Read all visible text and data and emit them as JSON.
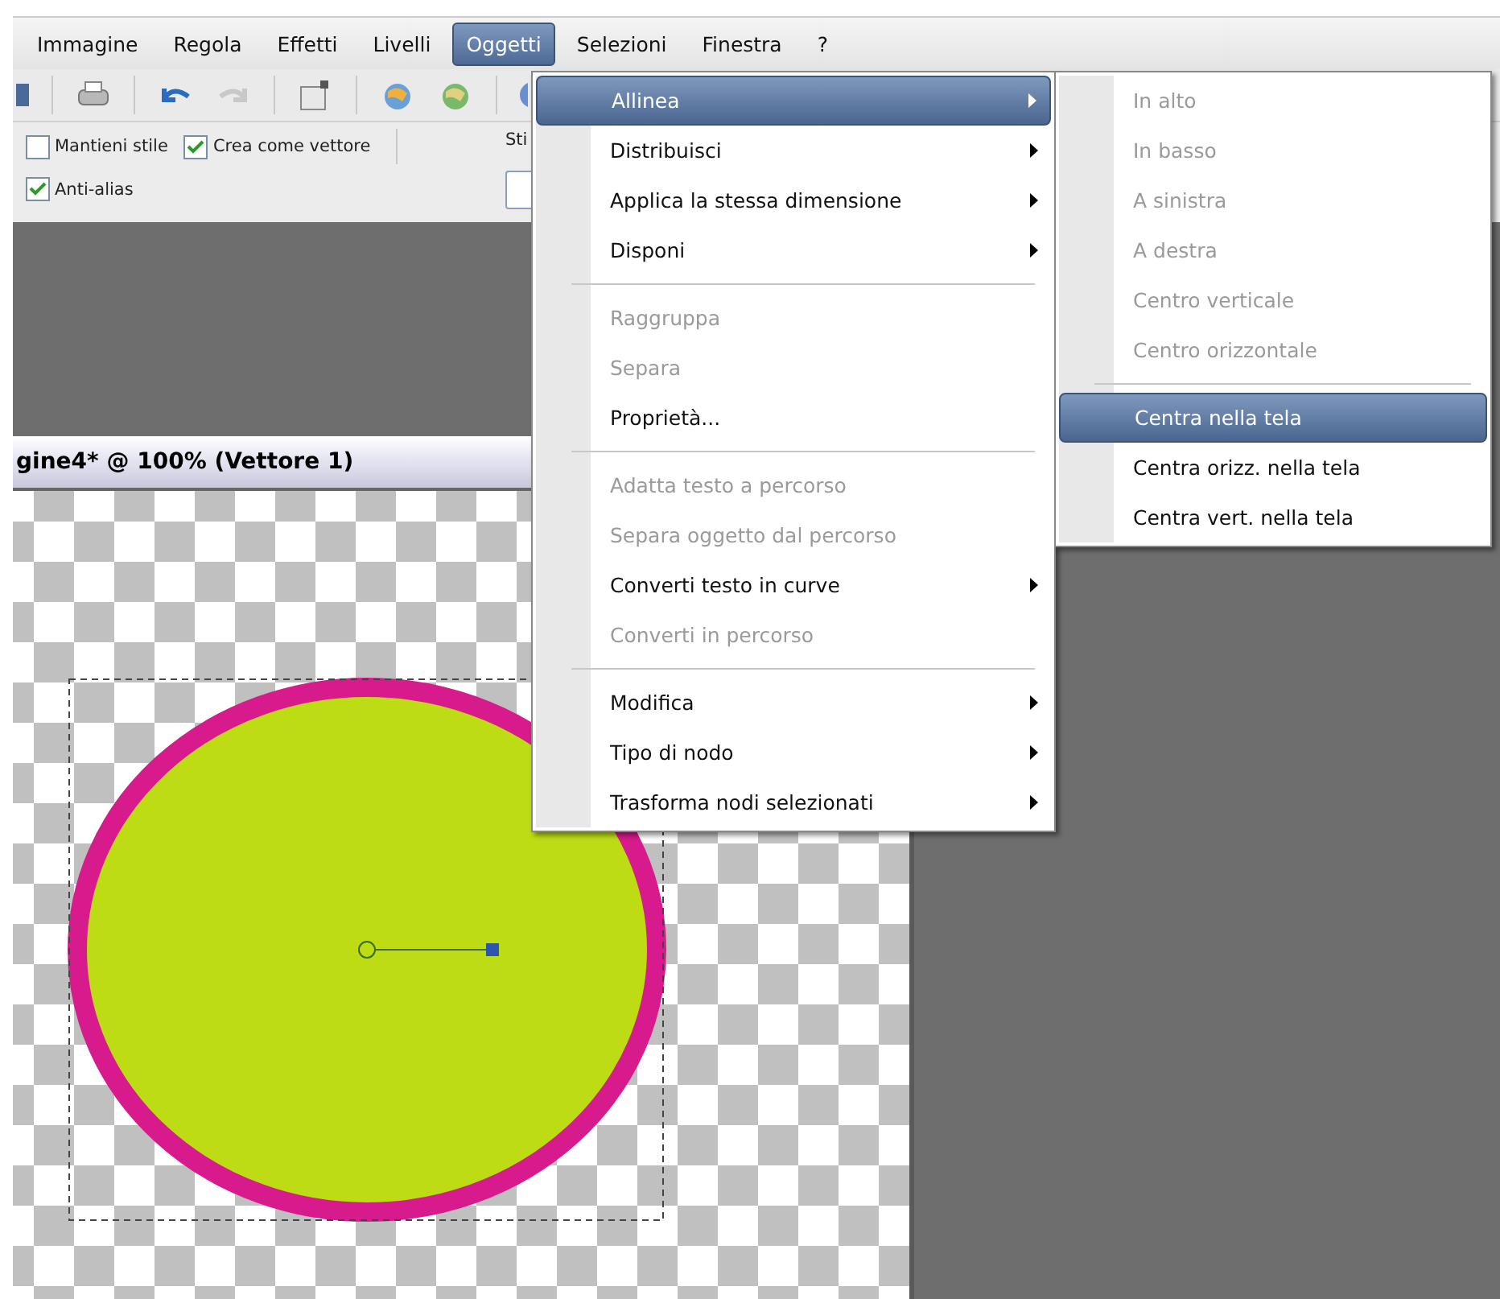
{
  "menubar": [
    {
      "label": "Immagine",
      "selected": false
    },
    {
      "label": "Regola",
      "selected": false
    },
    {
      "label": "Effetti",
      "selected": false
    },
    {
      "label": "Livelli",
      "selected": false
    },
    {
      "label": "Oggetti",
      "selected": true
    },
    {
      "label": "Selezioni",
      "selected": false
    },
    {
      "label": "Finestra",
      "selected": false
    },
    {
      "label": "?",
      "selected": false
    }
  ],
  "options": {
    "checkboxes": [
      {
        "label": "Mantieni stile",
        "checked": false
      },
      {
        "label": "Crea come vettore",
        "checked": true
      },
      {
        "label": "Anti-alias",
        "checked": true
      }
    ],
    "style_label": "Sti"
  },
  "document": {
    "title": "gine4* @ 100% (Vettore 1)"
  },
  "menu": {
    "items": [
      {
        "kind": "item",
        "label": "Allinea",
        "selected": true,
        "disabled": false,
        "submenu": true
      },
      {
        "kind": "item",
        "label": "Distribuisci",
        "selected": false,
        "disabled": false,
        "submenu": true
      },
      {
        "kind": "item",
        "label": "Applica la stessa dimensione",
        "selected": false,
        "disabled": false,
        "submenu": true
      },
      {
        "kind": "item",
        "label": "Disponi",
        "selected": false,
        "disabled": false,
        "submenu": true
      },
      {
        "kind": "separator"
      },
      {
        "kind": "item",
        "label": "Raggruppa",
        "selected": false,
        "disabled": true,
        "submenu": false
      },
      {
        "kind": "item",
        "label": "Separa",
        "selected": false,
        "disabled": true,
        "submenu": false
      },
      {
        "kind": "item",
        "label": "Proprietà...",
        "selected": false,
        "disabled": false,
        "submenu": false
      },
      {
        "kind": "separator"
      },
      {
        "kind": "item",
        "label": "Adatta testo a percorso",
        "selected": false,
        "disabled": true,
        "submenu": false
      },
      {
        "kind": "item",
        "label": "Separa oggetto dal percorso",
        "selected": false,
        "disabled": true,
        "submenu": false
      },
      {
        "kind": "item",
        "label": "Converti testo in curve",
        "selected": false,
        "disabled": false,
        "submenu": true
      },
      {
        "kind": "item",
        "label": "Converti in percorso",
        "selected": false,
        "disabled": true,
        "submenu": false
      },
      {
        "kind": "separator"
      },
      {
        "kind": "item",
        "label": "Modifica",
        "selected": false,
        "disabled": false,
        "submenu": true
      },
      {
        "kind": "item",
        "label": "Tipo di nodo",
        "selected": false,
        "disabled": false,
        "submenu": true
      },
      {
        "kind": "item",
        "label": "Trasforma nodi selezionati",
        "selected": false,
        "disabled": false,
        "submenu": true
      }
    ]
  },
  "submenu": {
    "items": [
      {
        "kind": "item",
        "label": "In alto",
        "selected": false,
        "disabled": true,
        "submenu": false
      },
      {
        "kind": "item",
        "label": "In basso",
        "selected": false,
        "disabled": true,
        "submenu": false
      },
      {
        "kind": "item",
        "label": "A sinistra",
        "selected": false,
        "disabled": true,
        "submenu": false
      },
      {
        "kind": "item",
        "label": "A destra",
        "selected": false,
        "disabled": true,
        "submenu": false
      },
      {
        "kind": "item",
        "label": "Centro verticale",
        "selected": false,
        "disabled": true,
        "submenu": false
      },
      {
        "kind": "item",
        "label": "Centro orizzontale",
        "selected": false,
        "disabled": true,
        "submenu": false
      },
      {
        "kind": "separator"
      },
      {
        "kind": "item",
        "label": "Centra nella tela",
        "selected": true,
        "disabled": false,
        "submenu": false
      },
      {
        "kind": "item",
        "label": "Centra orizz. nella tela",
        "selected": false,
        "disabled": false,
        "submenu": false
      },
      {
        "kind": "item",
        "label": "Centra vert. nella tela",
        "selected": false,
        "disabled": false,
        "submenu": false
      }
    ]
  }
}
